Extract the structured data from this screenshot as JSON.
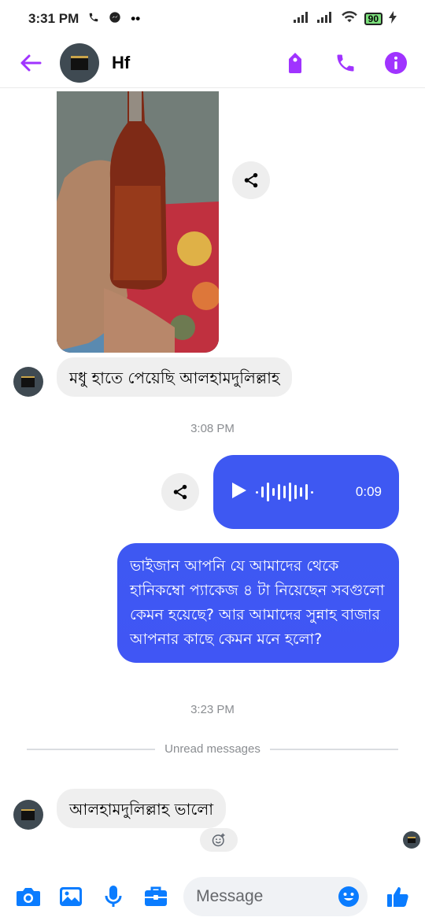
{
  "status_bar": {
    "time": "3:31 PM",
    "battery": "90"
  },
  "header": {
    "contact_name": "Hf"
  },
  "colors": {
    "accent": "#a033ff",
    "outgoing_bubble": "#3e58f2",
    "incoming_bubble": "#efefef",
    "like": "#0a7cff"
  },
  "messages": {
    "incoming_1": "মধু হাতে পেয়েছি আলহামদুলিল্লাহ",
    "time_1": "3:08 PM",
    "voice_duration": "0:09",
    "outgoing_1": "ভাইজান আপনি যে আমাদের থেকে হানিকম্বো প্যাকেজ ৪ টা নিয়েছেন সবগুলো  কেমন হয়েছে?  আর আমাদের সুন্নাহ বাজার আপনার কাছে কেমন মনে হলো?",
    "time_2": "3:23 PM",
    "unread_divider": "Unread messages",
    "incoming_2": "আলহামদুলিল্লাহ ভালো"
  },
  "composer": {
    "placeholder": "Message"
  }
}
